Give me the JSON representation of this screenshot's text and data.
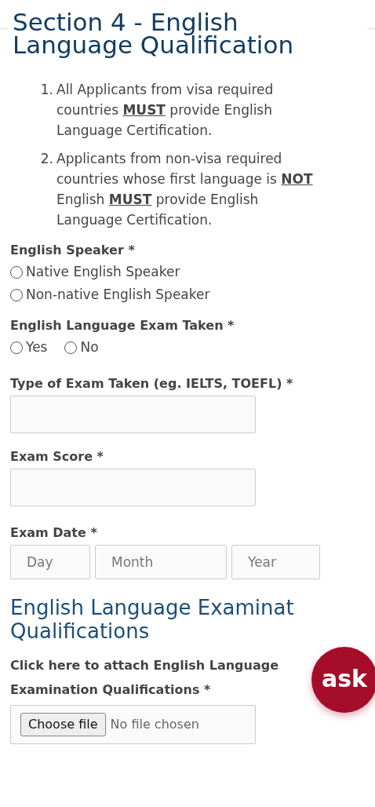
{
  "section_title": "Section 4 - English Language Qualification",
  "instructions": [
    {
      "marker": "1.",
      "text": "All Applicants from visa required countries **MUST** provide English Language Certification."
    },
    {
      "marker": "2.",
      "text": "Applicants from non-visa required countries whose first language is **NOT** English **MUST** provide English Language Certification."
    }
  ],
  "fields": [
    {
      "kind": "radio-list",
      "label": "English Speaker *",
      "options": [
        {
          "label": "Native English Speaker",
          "selected": false
        },
        {
          "label": "Non-native English Speaker",
          "selected": false
        }
      ]
    },
    {
      "kind": "radio-inline",
      "label": "English Language Exam Taken *",
      "options": [
        {
          "label": "Yes",
          "selected": false
        },
        {
          "label": "No",
          "selected": false
        }
      ]
    },
    {
      "kind": "text",
      "label": "Type of Exam Taken (eg. IELTS, TOEFL) *"
    },
    {
      "kind": "text",
      "label": "Exam Score *"
    },
    {
      "kind": "date",
      "label": "Exam Date *",
      "selects": [
        "Day",
        "Month",
        "Year"
      ]
    }
  ],
  "subsection_title": "English Language Examinat",
  "subsection_title_line2": "Qualifications",
  "attachment": {
    "label": "Click here to attach English Language Examination Qualifications *",
    "button": "Choose file",
    "status": "No file chosen"
  },
  "ask_button": "ask"
}
